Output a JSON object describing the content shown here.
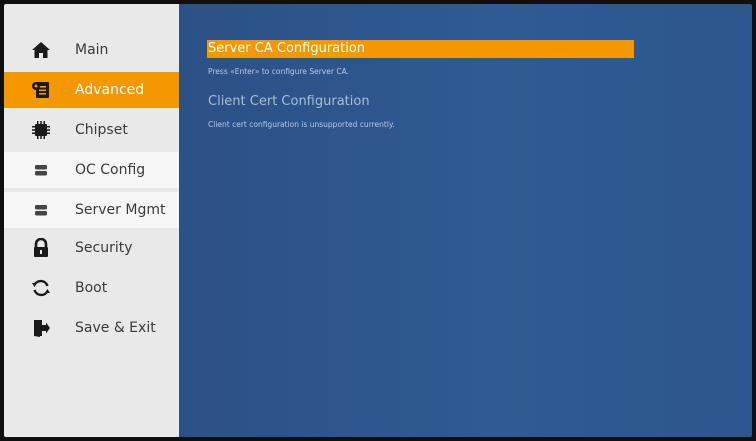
{
  "sidebar": {
    "items": [
      {
        "label": "Main",
        "icon": "home-icon",
        "state": "normal"
      },
      {
        "label": "Advanced",
        "icon": "advanced-icon",
        "state": "active"
      },
      {
        "label": "Chipset",
        "icon": "chip-icon",
        "state": "normal"
      },
      {
        "label": "OC Config",
        "icon": "server-icon",
        "state": "hover"
      },
      {
        "label": "Server Mgmt",
        "icon": "server-icon",
        "state": "hover"
      },
      {
        "label": "Security",
        "icon": "lock-icon",
        "state": "normal"
      },
      {
        "label": "Boot",
        "icon": "refresh-icon",
        "state": "normal"
      },
      {
        "label": "Save & Exit",
        "icon": "exit-icon",
        "state": "normal"
      }
    ]
  },
  "main": {
    "options": [
      {
        "title": "Server CA Configuration",
        "description": "Press «Enter» to configure Server CA.",
        "selected": true
      },
      {
        "title": "Client Cert Configuration",
        "description": "Client cert configuration is unsupported currently.",
        "selected": false
      }
    ]
  },
  "colors": {
    "accent": "#f39800",
    "sidebar_bg": "#e9e9e9",
    "main_bg": "#2d558d"
  }
}
